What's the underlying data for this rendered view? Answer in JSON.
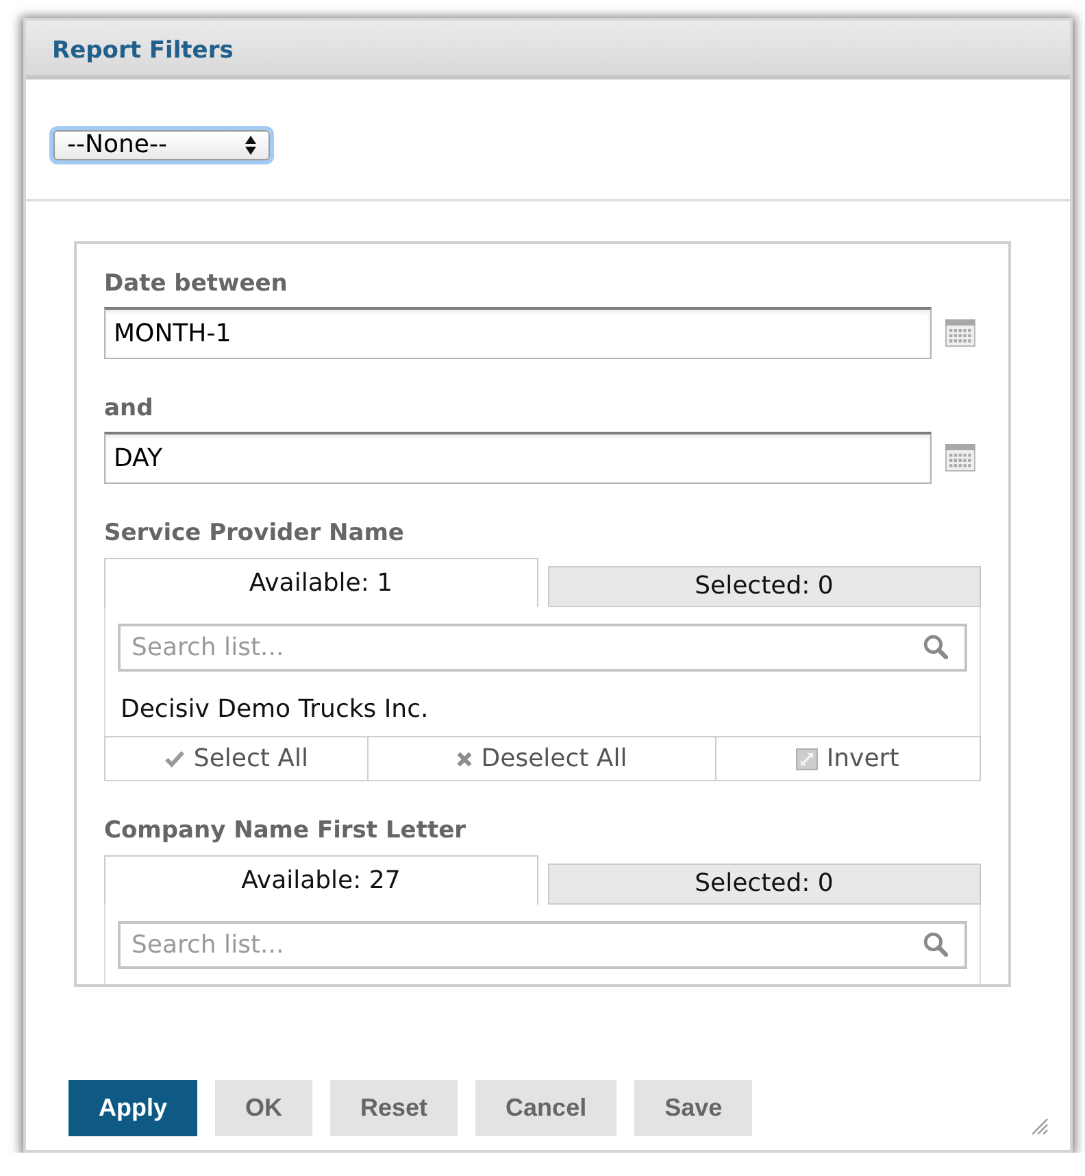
{
  "window": {
    "title": "Report Filters"
  },
  "preset": {
    "value": "--None--"
  },
  "filters": [
    {
      "kind": "date",
      "label": "Date between",
      "value": "MONTH-1"
    },
    {
      "kind": "date",
      "label": "and",
      "value": "DAY"
    },
    {
      "kind": "picklist",
      "label": "Service Provider Name",
      "tabs": [
        {
          "label": "Available: 1",
          "selected": true
        },
        {
          "label": "Selected: 0",
          "selected": false
        }
      ],
      "search": {
        "placeholder": "Search list..."
      },
      "items": [
        "Decisiv Demo Trucks Inc."
      ],
      "actions": [
        {
          "kind": "select",
          "label": "Select All"
        },
        {
          "kind": "deselect",
          "label": "Deselect All"
        },
        {
          "kind": "invert",
          "label": "Invert"
        }
      ]
    },
    {
      "kind": "picklist",
      "label": "Company Name First Letter",
      "tabs": [
        {
          "label": "Available: 27",
          "selected": true
        },
        {
          "label": "Selected: 0",
          "selected": false
        }
      ],
      "search": {
        "placeholder": "Search list..."
      }
    }
  ],
  "buttons": [
    {
      "label": "Apply",
      "primary": true
    },
    {
      "label": "OK",
      "primary": false
    },
    {
      "label": "Reset",
      "primary": false
    },
    {
      "label": "Cancel",
      "primary": false
    },
    {
      "label": "Save",
      "primary": false
    }
  ]
}
